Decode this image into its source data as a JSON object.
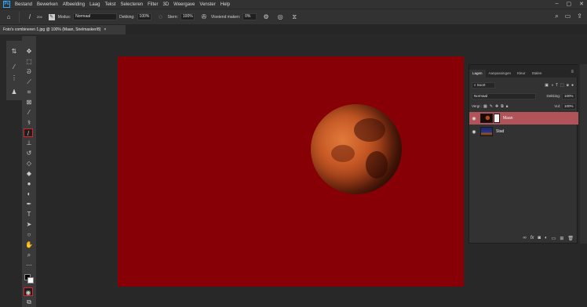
{
  "app": {
    "logo": "Ps",
    "menu": [
      "Bestand",
      "Bewerken",
      "Afbeelding",
      "Laag",
      "Tekst",
      "Selecteren",
      "Filter",
      "3D",
      "Weergave",
      "Venster",
      "Help"
    ],
    "window_controls": [
      "–",
      "▢",
      "✕"
    ]
  },
  "options": {
    "brush_size": "204",
    "mode_label": "Modus:",
    "mode_value": "Normaal",
    "opacity_label": "Dekking:",
    "opacity_value": "100%",
    "flow_label": "Stern:",
    "flow_value": "100%",
    "smoothing_label": "Vloeiend maken:",
    "smoothing_value": "0%"
  },
  "document": {
    "tab_title": "Foto's combineren 1.jpg @ 100% (Maan, Snelmasker/8)",
    "close_glyph": "×",
    "canvas_color": "#870005"
  },
  "layers_panel": {
    "tabs": [
      "Lagen",
      "Aanpassingen",
      "Kleur",
      "Stalen"
    ],
    "active_tab": "Lagen",
    "menu_glyph": "≡",
    "filter_label": "Soort",
    "blend_mode": "Normaal",
    "opacity_label": "Dekking:",
    "opacity_value": "100%",
    "lock_label": "Vergr.:",
    "fill_label": "Vul:",
    "fill_value": "100%",
    "layers": [
      {
        "name": "Maan",
        "selected": true,
        "visible": true
      },
      {
        "name": "Stad",
        "selected": false,
        "visible": true
      }
    ]
  },
  "colors": {
    "accent": "#31a8ff",
    "highlight_outline": "#e0202a",
    "selected_layer": "#b0545a"
  },
  "icons": {
    "home": "home-icon",
    "brush": "brush-icon",
    "search": "search-icon",
    "share": "share-icon"
  }
}
